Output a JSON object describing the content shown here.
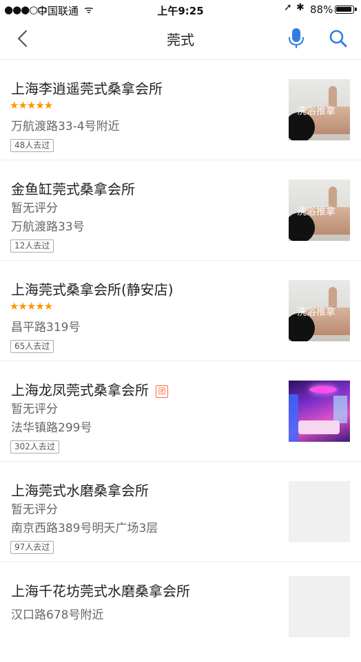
{
  "status_bar": {
    "signal": "●●●○○",
    "carrier": "中国联通",
    "wifi": "ᯤ",
    "time": "上午9:25",
    "location_glyph": "➚",
    "bluetooth_glyph": "✱",
    "battery": "88%"
  },
  "nav": {
    "title": "莞式",
    "accent": "#2f7de1"
  },
  "list": [
    {
      "name": "上海李逍遥莞式桑拿会所",
      "rating": "★★★★★",
      "address": "万航渡路33-4号附近",
      "visits": "48人去过",
      "watermark": "洗浴推拿"
    },
    {
      "name": "金鱼缸莞式桑拿会所",
      "no_rating": "暂无评分",
      "address": "万航渡路33号",
      "visits": "12人去过",
      "watermark": "洗浴推拿"
    },
    {
      "name": "上海莞式桑拿会所(静安店)",
      "rating": "★★★★★",
      "address": "昌平路319号",
      "visits": "65人去过",
      "watermark": "洗浴推拿"
    },
    {
      "name": "上海龙凤莞式桑拿会所",
      "badge": "团",
      "no_rating": "暂无评分",
      "address": "法华镇路299号",
      "visits": "302人去过"
    },
    {
      "name": "上海莞式水磨桑拿会所",
      "no_rating": "暂无评分",
      "address": "南京西路389号明天广场3层",
      "visits": "97人去过"
    },
    {
      "name": "上海千花坊莞式水磨桑拿会所",
      "address": "汉口路678号附近"
    }
  ]
}
